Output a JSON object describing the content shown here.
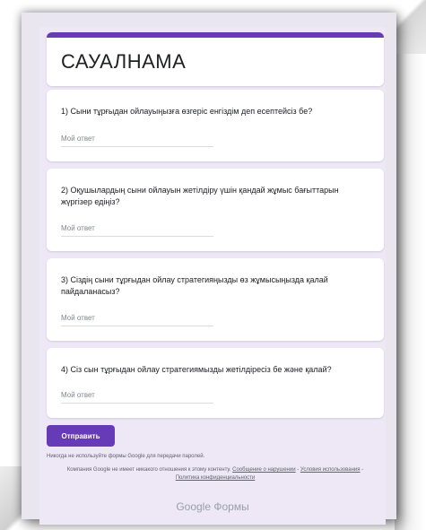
{
  "form": {
    "title": "САУАЛНАМА",
    "accent": "#673ab7",
    "questions": [
      {
        "text": "1) Сыни тұрғыдан ойлауыңызға өзгеріс енгіздім деп есептейсіз бе?",
        "answer_placeholder": "Мой ответ"
      },
      {
        "text": "2) Оқушылардың сыни ойлауын жетілдіру үшін қандай жұмыс бағыттарын жүргізер едіңіз?",
        "answer_placeholder": "Мой ответ"
      },
      {
        "text": "3) Сіздің сыни тұрғыдан ойлау стратегияңызды өз жұмысыңызда қалай пайдаланасыз?",
        "answer_placeholder": "Мой ответ"
      },
      {
        "text": "4) Сіз сын тұрғыдан ойлау стратегиямызды жетілдіресіз бе және қалай?",
        "answer_placeholder": "Мой ответ"
      }
    ],
    "submit_label": "Отправить",
    "footer": {
      "never_password": "Никогда не используйте формы Google для передачи паролей.",
      "disclaimer": "Компания Google не имеет никакого отношения к этому контенту.",
      "report_link": "Сообщение о нарушении",
      "separator1": " - ",
      "terms_link": "Условия использования",
      "separator2": " - ",
      "privacy_link": "Политика конфиденциальности",
      "brand": "Google Формы"
    }
  }
}
